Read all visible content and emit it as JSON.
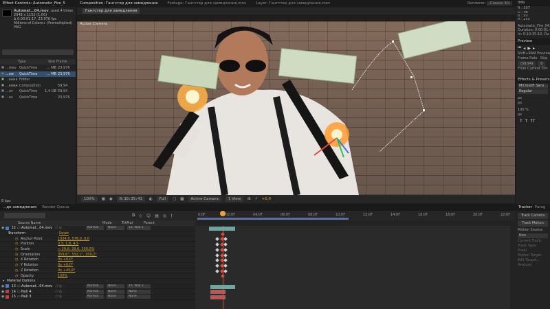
{
  "project": {
    "tab_label": "Effect Controls: Automatic_Fire_5",
    "file_name": "Automat...04.mov",
    "used_label": ", used 4 times",
    "dimensions": "2048 x 1152 (1,00)",
    "duration": "Δ 0:00:01:17, 23,976 fps",
    "colors": "Millions of Colors+ (Premultiplied)",
    "codec": "PNG",
    "columns": [
      "Type",
      "Size",
      "Frame"
    ],
    "items": [
      {
        "name": "...mov",
        "color": "#6f8fb0",
        "type": "QuickTime",
        "size": "... MB",
        "frame": "23,976",
        "selected": false
      },
      {
        "name": "...ow",
        "color": "#6f8fb0",
        "type": "QuickTime",
        "size": "... MB",
        "frame": "23,976",
        "selected": true
      },
      {
        "name": "...ения",
        "color": "#d7b84c",
        "type": "Folder",
        "size": "",
        "frame": "",
        "selected": false
      },
      {
        "name": "...ении",
        "color": "#9aa0c8",
        "type": "Composition",
        "size": "",
        "frame": "59,94",
        "selected": false
      },
      {
        "name": "...ov",
        "color": "#6f8fb0",
        "type": "QuickTime",
        "size": "1,4 GB",
        "frame": "59,94",
        "selected": false
      },
      {
        "name": "...ov",
        "color": "#6f8fb0",
        "type": "QuickTime",
        "size": "",
        "frame": "23,976",
        "selected": false
      }
    ],
    "bpc": "8 bpc"
  },
  "comp": {
    "tabs": [
      "Composition: Гангстер для замедления",
      "Footage: Гангстер для замедления.mov",
      "Layer: Гангстер для замедления.mov"
    ],
    "renderer_label": "Renderer:",
    "renderer_value": "Classic 3D",
    "comp_name_tab": "Гангстер для замедления",
    "viewer_label": "Active Camera",
    "zoom": "100%",
    "timecode": "0:10:35:41",
    "resolution": "Full",
    "camera": "Active Camera",
    "views": "1 View",
    "exposure": "+0,0"
  },
  "info": {
    "tab": "Info",
    "r": "R : 107",
    "g": "G : 96",
    "b": "B : 90",
    "a": "A : 255",
    "name": "Automatic_Fire_04.a",
    "duration": "Duration: 0:00:01:4",
    "in_out": "In: 0:10:35:13, Ou"
  },
  "preview": {
    "tab": "Preview",
    "ram": "Shift+RAM Preview",
    "frame_rate_label": "Frame Rate",
    "skip_label": "Skip",
    "frame_rate_value": "(59,94)",
    "skip_value": "0",
    "from_current": "From Current Tim"
  },
  "effects": {
    "tab": "Effects & Presets",
    "font": "Microsoft Sans ...",
    "style": "Regular",
    "size1": "px",
    "size2": "px",
    "scale1": "100 %",
    "scale2": "px"
  },
  "tracker": {
    "tabs": [
      "Tracker",
      "Parag"
    ],
    "track_camera": "Track Camera",
    "track_motion": "Track Motion",
    "motion_source_label": "Motion Source:",
    "motion_source_value": "Non",
    "current_track": "Current Track:",
    "track_type": "Track Type:",
    "motion_target": "Motion Target:",
    "edit_target": "Edit Target...",
    "analyze_label": "Analyze:",
    "position_label": "Positi"
  },
  "timeline": {
    "tabs": [
      "...де замедления",
      "Render Queue"
    ],
    "search_placeholder": "",
    "columns": {
      "source": "Source Name",
      "mode": "Mode",
      "trkmat": "TrkMat",
      "parent": "Parent"
    },
    "ruler_ticks": [
      "0:0F",
      "02:0F",
      "04:0F",
      "06:0F",
      "08:0F",
      "10:0F",
      "12:0F",
      "14:0F",
      "16:0F",
      "18:0F",
      "20:0F",
      "22:0F"
    ],
    "layers": [
      {
        "num": "12",
        "chip": "#3d80c5",
        "name": "Automat...04.mov",
        "mode": "Normal",
        "trkmat": "None",
        "parent": "15. Null 3"
      }
    ],
    "transform_label": "Transform",
    "reset_label": "Reset",
    "props": [
      {
        "name": "Anchor Point",
        "value": "1024,0, 576,0, 0,0"
      },
      {
        "name": "Position",
        "value": "0,3, 1,8, 4,5"
      },
      {
        "name": "Scale",
        "value": "∞ 29,6, 29,6, 100,0%"
      },
      {
        "name": "Orientation",
        "value": "359,6°, 332,1°, 359,2°"
      },
      {
        "name": "X Rotation",
        "value": "0x +0,0°"
      },
      {
        "name": "Y Rotation",
        "value": "0x +0,0°"
      },
      {
        "name": "Z Rotation",
        "value": "0x +45,6°"
      },
      {
        "name": "Opacity",
        "value": "100%"
      }
    ],
    "material_label": "Material Options",
    "bottom_layers": [
      {
        "num": "13",
        "chip": "#3d80c5",
        "name": "Automat...04.mov",
        "mode": "Normal",
        "trkmat": "None",
        "parent": "15. Null 3"
      },
      {
        "num": "14",
        "chip": "#c04040",
        "name": "Null 4",
        "mode": "Normal",
        "trkmat": "None",
        "parent": "None"
      },
      {
        "num": "15",
        "chip": "#c04040",
        "name": "Null 3",
        "mode": "Normal",
        "trkmat": "None",
        "parent": "None"
      }
    ]
  },
  "colors": {
    "accent_blue": "#35506e",
    "keyframe_red": "#e54a3a",
    "value_yellow": "#c9a227",
    "layer_blue": "#3d80c5",
    "layer_red": "#c04040"
  }
}
